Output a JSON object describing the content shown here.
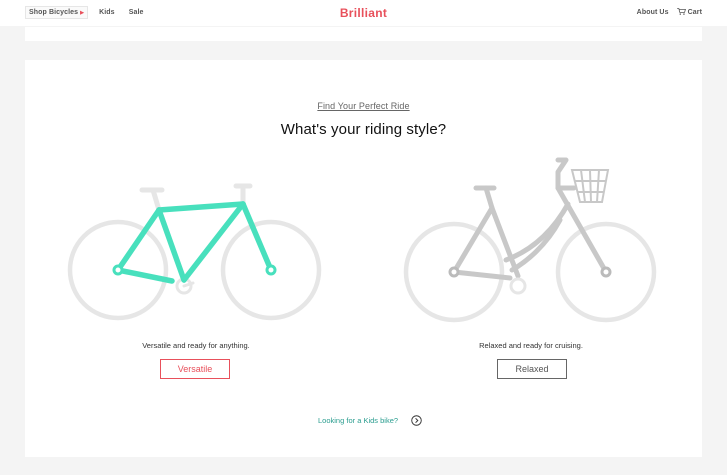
{
  "nav": {
    "left_items": [
      "Shop Bicycles",
      "Kids",
      "Sale"
    ],
    "brand": "Brilliant",
    "about": "About Us",
    "cart": "Cart"
  },
  "main": {
    "eyebrow": "Find Your Perfect Ride",
    "headline": "What's your riding style?",
    "options": [
      {
        "caption": "Versatile and ready for anything.",
        "button": "Versatile"
      },
      {
        "caption": "Relaxed and ready for cruising.",
        "button": "Relaxed"
      }
    ],
    "kids_link": "Looking for a Kids bike?"
  },
  "colors": {
    "brand": "#e8505b",
    "frame_highlight": "#48e0bd",
    "frame_muted": "#c8c8c8",
    "wheel": "#e6e6e6",
    "kids_link": "#2a9d8f"
  }
}
